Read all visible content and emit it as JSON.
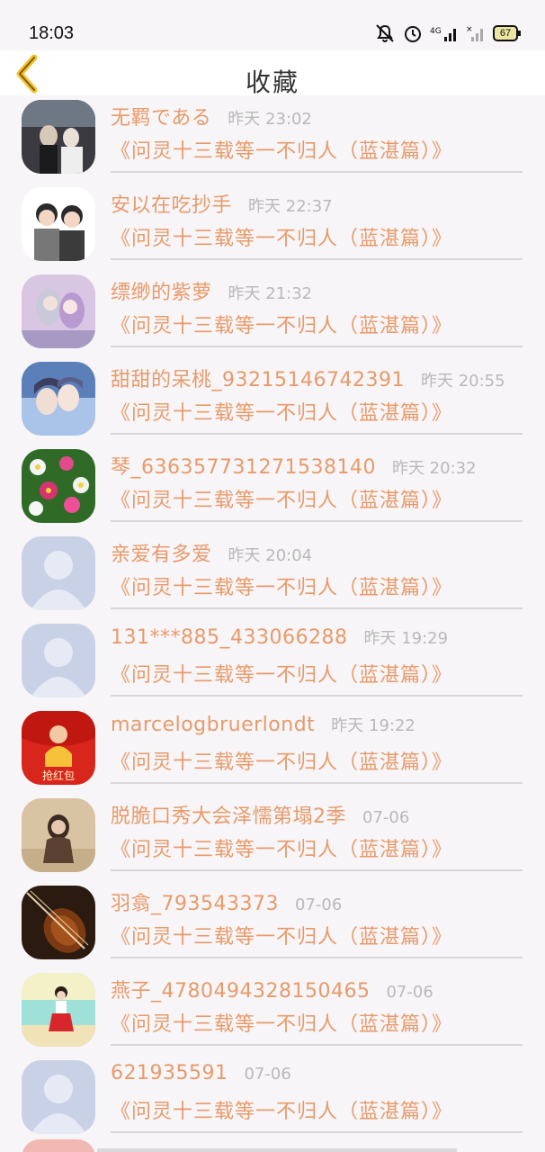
{
  "status_bar": {
    "time": "18:03",
    "icons": [
      "mute-icon",
      "alarm-icon",
      "signal-4g-icon",
      "signal-icon"
    ],
    "battery": "67"
  },
  "nav": {
    "back_icon": "chevron-left-icon",
    "title": "收藏"
  },
  "items": [
    {
      "name": "无羁である",
      "time": "昨天 23:02",
      "book": "《问灵十三载等一不归人（蓝湛篇）》",
      "avatar": "photo-couple"
    },
    {
      "name": "安以在吃抄手",
      "time": "昨天 22:37",
      "book": "《问灵十三载等一不归人（蓝湛篇）》",
      "avatar": "cartoon-boys"
    },
    {
      "name": "缥缈的紫萝",
      "time": "昨天 21:32",
      "book": "《问灵十三载等一不归人（蓝湛篇）》",
      "avatar": "anime-pair"
    },
    {
      "name": "甜甜的呆桃_93215146742391",
      "time": "昨天 20:55",
      "book": "《问灵十三载等一不归人（蓝湛篇）》",
      "avatar": "anime-kiss"
    },
    {
      "name": "琴_636357731271538140",
      "time": "昨天 20:32",
      "book": "《问灵十三载等一不归人（蓝湛篇）》",
      "avatar": "flowers"
    },
    {
      "name": "亲爱有多爱",
      "time": "昨天 20:04",
      "book": "《问灵十三载等一不归人（蓝湛篇）》",
      "avatar": "default"
    },
    {
      "name": "131***885_433066288",
      "time": "昨天 19:29",
      "book": "《问灵十三载等一不归人（蓝湛篇）》",
      "avatar": "default"
    },
    {
      "name": "marcelogbruerlondt",
      "time": "昨天 19:22",
      "book": "《问灵十三载等一不归人（蓝湛篇）》",
      "avatar": "red-packet",
      "avatar_text": "抢红包"
    },
    {
      "name": "脱脆口秀大会泽懦第塌2季",
      "time": "07-06",
      "book": "《问灵十三载等一不归人（蓝湛篇）》",
      "avatar": "beach-girl"
    },
    {
      "name": "羽翕_793543373",
      "time": "07-06",
      "book": "《问灵十三载等一不归人（蓝湛篇）》",
      "avatar": "violin"
    },
    {
      "name": "燕子_4780494328150465",
      "time": "07-06",
      "book": "《问灵十三载等一不归人（蓝湛篇）》",
      "avatar": "sea-girl"
    },
    {
      "name": "621935591",
      "time": "07-06",
      "book": "《问灵十三载等一不归人（蓝湛篇）》",
      "avatar": "default"
    }
  ],
  "colors": {
    "accent": "#e89a6a",
    "back_arrow": "#f2c12e",
    "time_gray": "#b9b9b9",
    "background": "#f7f5f7"
  }
}
